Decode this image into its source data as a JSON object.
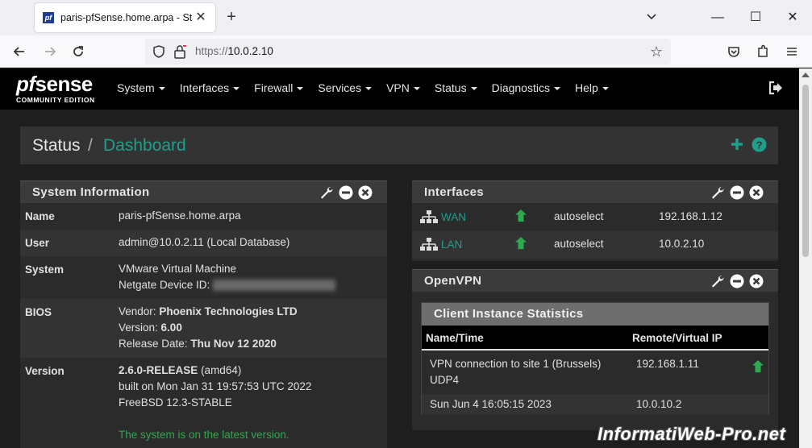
{
  "browser": {
    "tab_title": "paris-pfSense.home.arpa - Statu",
    "url_scheme": "https://",
    "url_host": "10.0.2.10",
    "favicon_text": "pf"
  },
  "app": {
    "logo_main_pf": "pf",
    "logo_main_sense": "sense",
    "logo_sub": "COMMUNITY EDITION",
    "menu": [
      "System",
      "Interfaces",
      "Firewall",
      "Services",
      "VPN",
      "Status",
      "Diagnostics",
      "Help"
    ],
    "breadcrumb": {
      "section": "Status",
      "separator": "/",
      "page": "Dashboard"
    },
    "accent_color": "#1f9e8c",
    "up_color": "#2ea94f"
  },
  "system_info": {
    "title": "System Information",
    "name_key": "Name",
    "name_val": "paris-pfSense.home.arpa",
    "user_key": "User",
    "user_val": "admin@10.0.2.11 (Local Database)",
    "system_key": "System",
    "system_val": "VMware Virtual Machine",
    "device_id_label": "Netgate Device ID:",
    "bios_key": "BIOS",
    "bios_vendor_label": "Vendor:",
    "bios_vendor": "Phoenix Technologies LTD",
    "bios_version_label": "Version:",
    "bios_version": "6.00",
    "bios_release_label": "Release Date:",
    "bios_release": "Thu Nov 12 2020",
    "version_key": "Version",
    "version_num": "2.6.0-RELEASE",
    "version_arch": "(amd64)",
    "version_built": "built on Mon Jan 31 19:57:53 UTC 2022",
    "version_os": "FreeBSD 12.3-STABLE",
    "version_status": "The system is on the latest version."
  },
  "interfaces": {
    "title": "Interfaces",
    "rows": [
      {
        "name": "WAN",
        "media": "autoselect",
        "ip": "192.168.1.12"
      },
      {
        "name": "LAN",
        "media": "autoselect",
        "ip": "10.0.2.10"
      }
    ]
  },
  "openvpn": {
    "title": "OpenVPN",
    "sub_title": "Client Instance Statistics",
    "col_name": "Name/Time",
    "col_ip": "Remote/Virtual IP",
    "conn_name": "VPN connection to site 1 (Brussels)",
    "conn_proto": "UDP4",
    "conn_remote": "192.168.1.11",
    "conn_time": "Sun Jun 4 16:05:15 2023",
    "conn_virtual": "10.0.10.2"
  },
  "watermark": "InformatiWeb-Pro.net"
}
